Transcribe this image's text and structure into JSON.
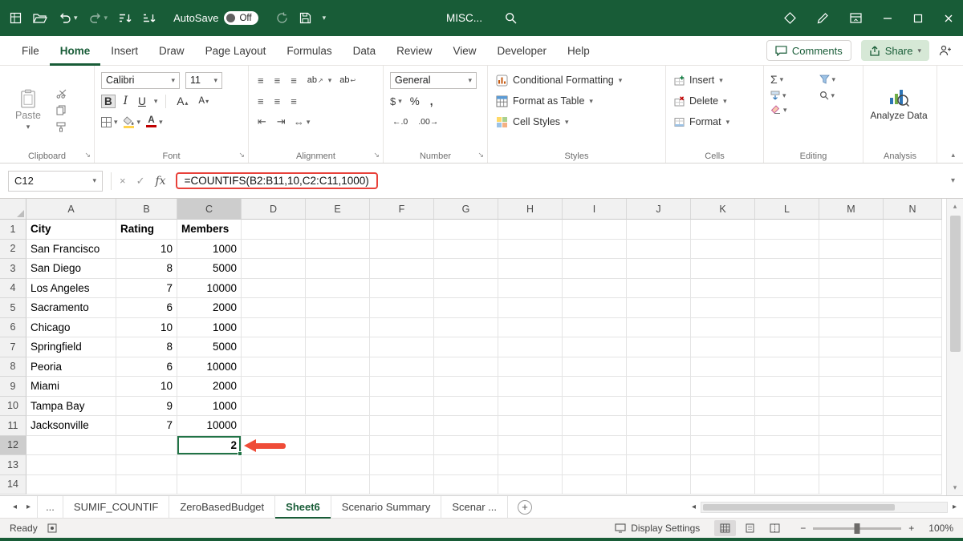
{
  "titlebar": {
    "autosave_label": "AutoSave",
    "autosave_state": "Off",
    "doc_title": "MISC..."
  },
  "menu": {
    "tabs": [
      "File",
      "Home",
      "Insert",
      "Draw",
      "Page Layout",
      "Formulas",
      "Data",
      "Review",
      "View",
      "Developer",
      "Help"
    ],
    "active_tab": "Home",
    "comments_label": "Comments",
    "share_label": "Share"
  },
  "ribbon": {
    "paste_label": "Paste",
    "font_name": "Calibri",
    "font_size": "11",
    "bold_label": "B",
    "italic_label": "I",
    "underline_label": "U",
    "grow_font_label": "A",
    "shrink_font_label": "A",
    "font_color_label": "A",
    "number_format": "General",
    "currency_label": "$",
    "percent_label": "%",
    "comma_label": ",",
    "increase_decimal_label": "←.0",
    "decrease_decimal_label": ".00→",
    "conditional_formatting_label": "Conditional Formatting",
    "format_as_table_label": "Format as Table",
    "cell_styles_label": "Cell Styles",
    "insert_label": "Insert",
    "delete_label": "Delete",
    "format_label": "Format",
    "autosum_label": "Σ",
    "analyze_data_label": "Analyze Data",
    "group_labels": {
      "clipboard": "Clipboard",
      "font": "Font",
      "alignment": "Alignment",
      "number": "Number",
      "styles": "Styles",
      "cells": "Cells",
      "editing": "Editing",
      "analysis": "Analysis"
    }
  },
  "formula_bar": {
    "name_box": "C12",
    "fx_label": "fx",
    "formula": "=COUNTIFS(B2:B11,10,C2:C11,1000)"
  },
  "grid": {
    "column_headers": [
      "A",
      "B",
      "C",
      "D",
      "E",
      "F",
      "G",
      "H",
      "I",
      "J",
      "K",
      "L",
      "M",
      "N"
    ],
    "selected_column": "C",
    "selected_row": 12,
    "selected_cell": "C12",
    "rows": [
      {
        "n": 1,
        "bold": true,
        "cells": {
          "A": "City",
          "B": "Rating",
          "C": "Members"
        }
      },
      {
        "n": 2,
        "cells": {
          "A": "San Francisco",
          "B": "10",
          "C": "1000"
        }
      },
      {
        "n": 3,
        "cells": {
          "A": "San Diego",
          "B": "8",
          "C": "5000"
        }
      },
      {
        "n": 4,
        "cells": {
          "A": "Los Angeles",
          "B": "7",
          "C": "10000"
        }
      },
      {
        "n": 5,
        "cells": {
          "A": "Sacramento",
          "B": "6",
          "C": "2000"
        }
      },
      {
        "n": 6,
        "cells": {
          "A": "Chicago",
          "B": "10",
          "C": "1000"
        }
      },
      {
        "n": 7,
        "cells": {
          "A": "Springfield",
          "B": "8",
          "C": "5000"
        }
      },
      {
        "n": 8,
        "cells": {
          "A": "Peoria",
          "B": "6",
          "C": "10000"
        }
      },
      {
        "n": 9,
        "cells": {
          "A": "Miami",
          "B": "10",
          "C": "2000"
        }
      },
      {
        "n": 10,
        "cells": {
          "A": "Tampa Bay",
          "B": "9",
          "C": "1000"
        }
      },
      {
        "n": 11,
        "cells": {
          "A": "Jacksonville",
          "B": "7",
          "C": "10000"
        }
      },
      {
        "n": 12,
        "cells": {
          "C": "2"
        }
      },
      {
        "n": 13,
        "cells": {}
      },
      {
        "n": 14,
        "cells": {}
      }
    ]
  },
  "sheet_tabs": {
    "overflow_label": "...",
    "tabs": [
      "SUMIF_COUNTIF",
      "ZeroBasedBudget",
      "Sheet6",
      "Scenario Summary",
      "Scenar ..."
    ],
    "active_tab": "Sheet6",
    "add_label": "+"
  },
  "status_bar": {
    "mode": "Ready",
    "display_settings_label": "Display Settings",
    "zoom_out_label": "−",
    "zoom_in_label": "+",
    "zoom_level": "100%"
  },
  "glyphs": {
    "dropdown": "▾",
    "up": "▴",
    "left": "◂",
    "right": "▸",
    "launcher": "↘",
    "cancel": "×",
    "enter": "✓",
    "align": "≡",
    "orientation_text": "ab",
    "orientation_arrow": "↗",
    "wrap_text": "ab",
    "wrap_arrow": "↩",
    "indent_decrease": "⇤",
    "indent_increase": "⇥",
    "merge": "⇔",
    "collapse_ribbon": "▴"
  },
  "colors": {
    "titlebar_green": "#185C37",
    "selection_green": "#217346",
    "formula_highlight_red": "#E8413A",
    "annotation_arrow_red": "#EF4C38"
  }
}
